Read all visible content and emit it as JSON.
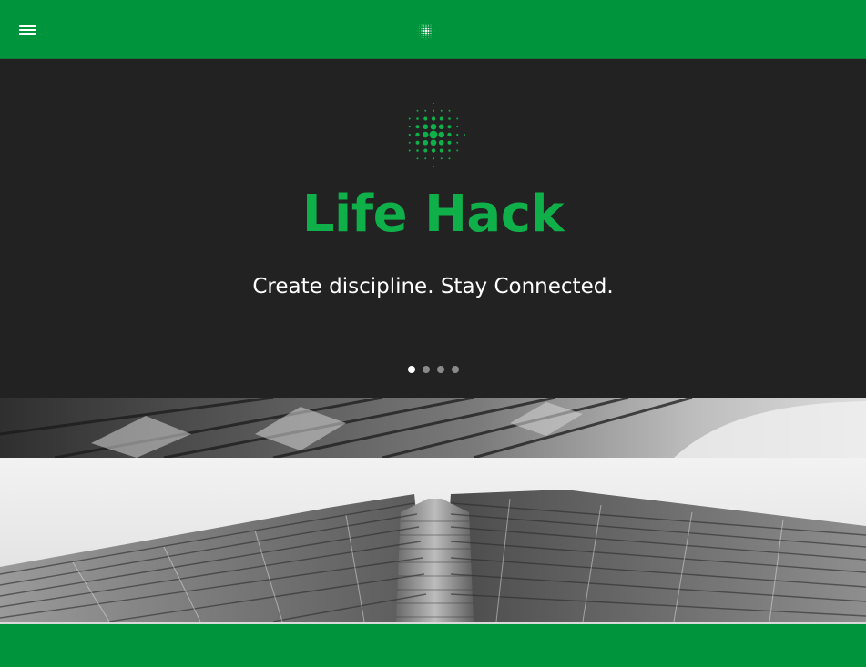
{
  "nav": {
    "menu_icon": "hamburger-menu-icon",
    "logo_icon": "dot-sphere-logo-icon"
  },
  "hero": {
    "logo_icon": "dot-sphere-logo-icon",
    "title": "Life Hack",
    "subtitle": "Create discipline. Stay Connected.",
    "slides": {
      "count": 4,
      "active_index": 0
    }
  },
  "images": {
    "strip": "building-facade-photo",
    "main": "skyscraper-looking-up-photo"
  },
  "colors": {
    "brand_green": "#00953d",
    "title_green": "#0fb04a",
    "hero_background": "#222222",
    "subtitle_text": "#ffffff"
  }
}
